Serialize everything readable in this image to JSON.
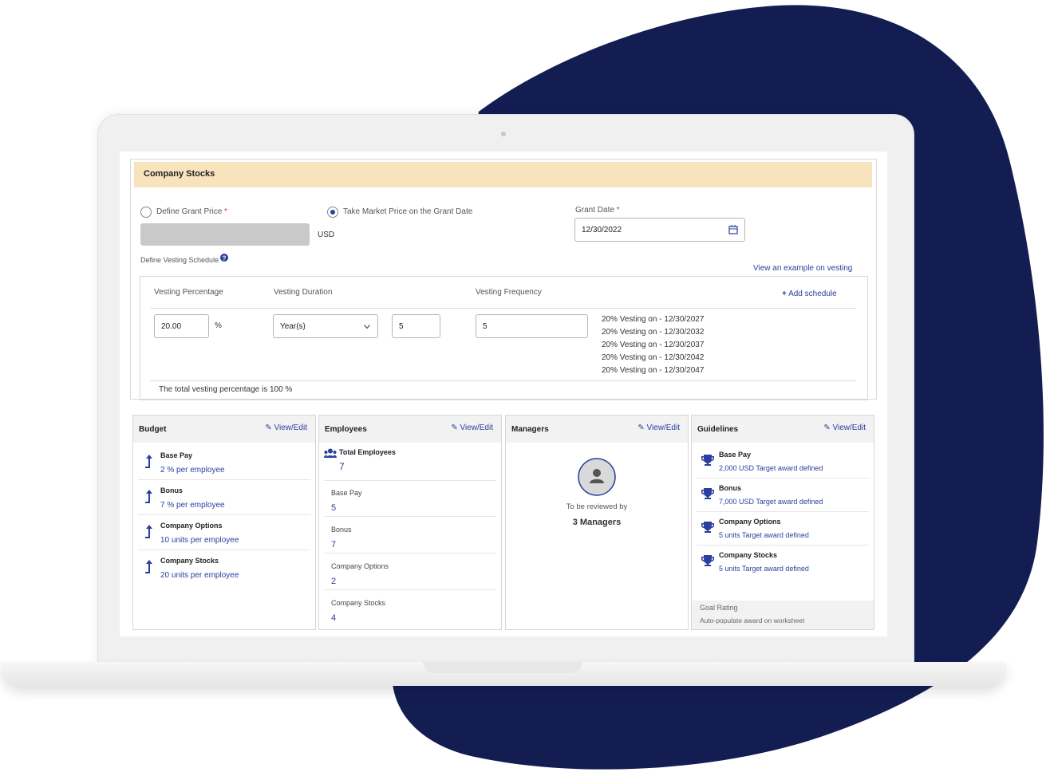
{
  "colors": {
    "navy": "#131d52",
    "link": "#2a3f9e",
    "header_bg": "#f7e4bd"
  },
  "section": {
    "title": "Company Stocks"
  },
  "grant": {
    "define_price_label": "Define Grant Price",
    "required_mark": "*",
    "market_price_label": "Take Market Price on the Grant Date",
    "market_price_selected": true,
    "currency": "USD",
    "grant_date_label": "Grant Date",
    "grant_date_value": "12/30/2022"
  },
  "vesting": {
    "define_label": "Define Vesting Schedule",
    "example_link": "View an example on vesting",
    "headers": {
      "percentage": "Vesting Percentage",
      "duration": "Vesting Duration",
      "frequency": "Vesting Frequency"
    },
    "add_schedule": "Add schedule",
    "percentage_value": "20.00",
    "percent_sign": "%",
    "duration_unit": "Year(s)",
    "duration_value": "5",
    "frequency_value": "5",
    "schedule": [
      "20% Vesting on - 12/30/2027",
      "20% Vesting on - 12/30/2032",
      "20% Vesting on - 12/30/2037",
      "20% Vesting on - 12/30/2042",
      "20% Vesting on - 12/30/2047"
    ],
    "total_text": "The total vesting percentage is 100 %"
  },
  "view_edit": "View/Edit",
  "budget": {
    "title": "Budget",
    "items": [
      {
        "label": "Base Pay",
        "value": "2 % per employee"
      },
      {
        "label": "Bonus",
        "value": "7 % per employee"
      },
      {
        "label": "Company Options",
        "value": "10 units per employee"
      },
      {
        "label": "Company Stocks",
        "value": "20 units per employee"
      }
    ]
  },
  "employees": {
    "title": "Employees",
    "total_label": "Total Employees",
    "total_value": "7",
    "items": [
      {
        "label": "Base Pay",
        "value": "5"
      },
      {
        "label": "Bonus",
        "value": "7"
      },
      {
        "label": "Company Options",
        "value": "2"
      },
      {
        "label": "Company Stocks",
        "value": "4"
      }
    ]
  },
  "managers": {
    "title": "Managers",
    "review_label": "To be reviewed by",
    "review_value": "3 Managers"
  },
  "guidelines": {
    "title": "Guidelines",
    "items": [
      {
        "label": "Base Pay",
        "value": "2,000 USD Target award defined"
      },
      {
        "label": "Bonus",
        "value": "7,000 USD Target award defined"
      },
      {
        "label": "Company Options",
        "value": "5 units Target award defined"
      },
      {
        "label": "Company Stocks",
        "value": "5 units Target award defined"
      }
    ],
    "goal_rating": "Goal Rating",
    "auto_populate": "Auto-populate award on worksheet"
  }
}
